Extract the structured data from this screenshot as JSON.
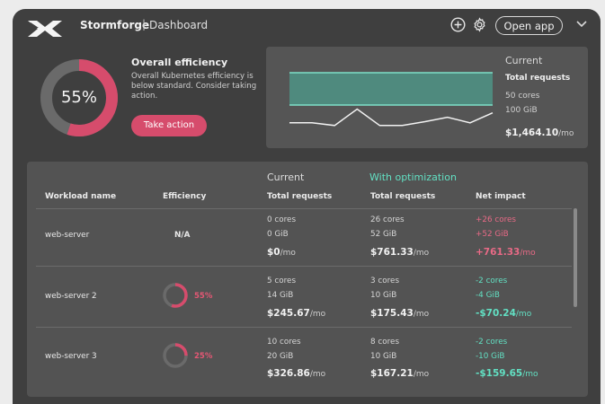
{
  "header": {
    "brand": "Stormforge",
    "separator": "|",
    "crumb": "Dashboard",
    "open_app_label": "Open app",
    "icons": [
      "x-logo-icon",
      "plus-circle-icon",
      "gear-icon",
      "chevron-down-icon"
    ]
  },
  "efficiency": {
    "percent_label": "55%",
    "percent_value": 55,
    "title": "Overall efficiency",
    "description": "Overall Kubernetes efficiency is below standard. Consider taking action.",
    "action_label": "Take action"
  },
  "current_summary": {
    "title": "Current",
    "subtitle": "Total requests",
    "cores": "50 cores",
    "memory": "100 GiB",
    "cost": "$1,464.10",
    "cost_unit": "/mo"
  },
  "usage_chart": {
    "requests_band_fraction": 0.5,
    "usage_series": [
      0.2,
      0.2,
      0.15,
      0.45,
      0.15,
      0.15,
      0.22,
      0.3,
      0.2,
      0.38
    ]
  },
  "table": {
    "group_current": "Current",
    "group_optimization": "With optimization",
    "columns": {
      "workload": "Workload name",
      "efficiency": "Efficiency",
      "current_requests": "Total requests",
      "optimized_requests": "Total requests",
      "net_impact": "Net impact"
    },
    "rows": [
      {
        "name": "web-server",
        "efficiency": "N/A",
        "cur_cores": "0 cores",
        "cur_mem": "0 GiB",
        "cur_cost": "$0",
        "cur_unit": "/mo",
        "opt_cores": "26 cores",
        "opt_mem": "52 GiB",
        "opt_cost": "$761.33",
        "opt_unit": "/mo",
        "net_cores": "+26 cores",
        "net_mem": "+52 GiB",
        "net_cost": "+761.33",
        "net_unit": "/mo"
      },
      {
        "name": "web-server 2",
        "efficiency": "55%",
        "efficiency_value": 55,
        "cur_cores": "5 cores",
        "cur_mem": "14 GiB",
        "cur_cost": "$245.67",
        "cur_unit": "/mo",
        "opt_cores": "3 cores",
        "opt_mem": "10 GiB",
        "opt_cost": "$175.43",
        "opt_unit": "/mo",
        "net_cores": "-2 cores",
        "net_mem": "-4 GiB",
        "net_cost": "-$70.24",
        "net_unit": "/mo"
      },
      {
        "name": "web-server 3",
        "efficiency": "25%",
        "efficiency_value": 25,
        "cur_cores": "10 cores",
        "cur_mem": "20 GiB",
        "cur_cost": "$326.86",
        "cur_unit": "/mo",
        "opt_cores": "8 cores",
        "opt_mem": "10 GiB",
        "opt_cost": "$167.21",
        "opt_unit": "/mo",
        "net_cores": "-2 cores",
        "net_mem": "-10 GiB",
        "net_cost": "-$159.65",
        "net_unit": "/mo"
      }
    ]
  },
  "colors": {
    "accent_pink": "#d64c6c",
    "accent_mint": "#62e0c3",
    "band_fill": "#4f8a7e"
  }
}
